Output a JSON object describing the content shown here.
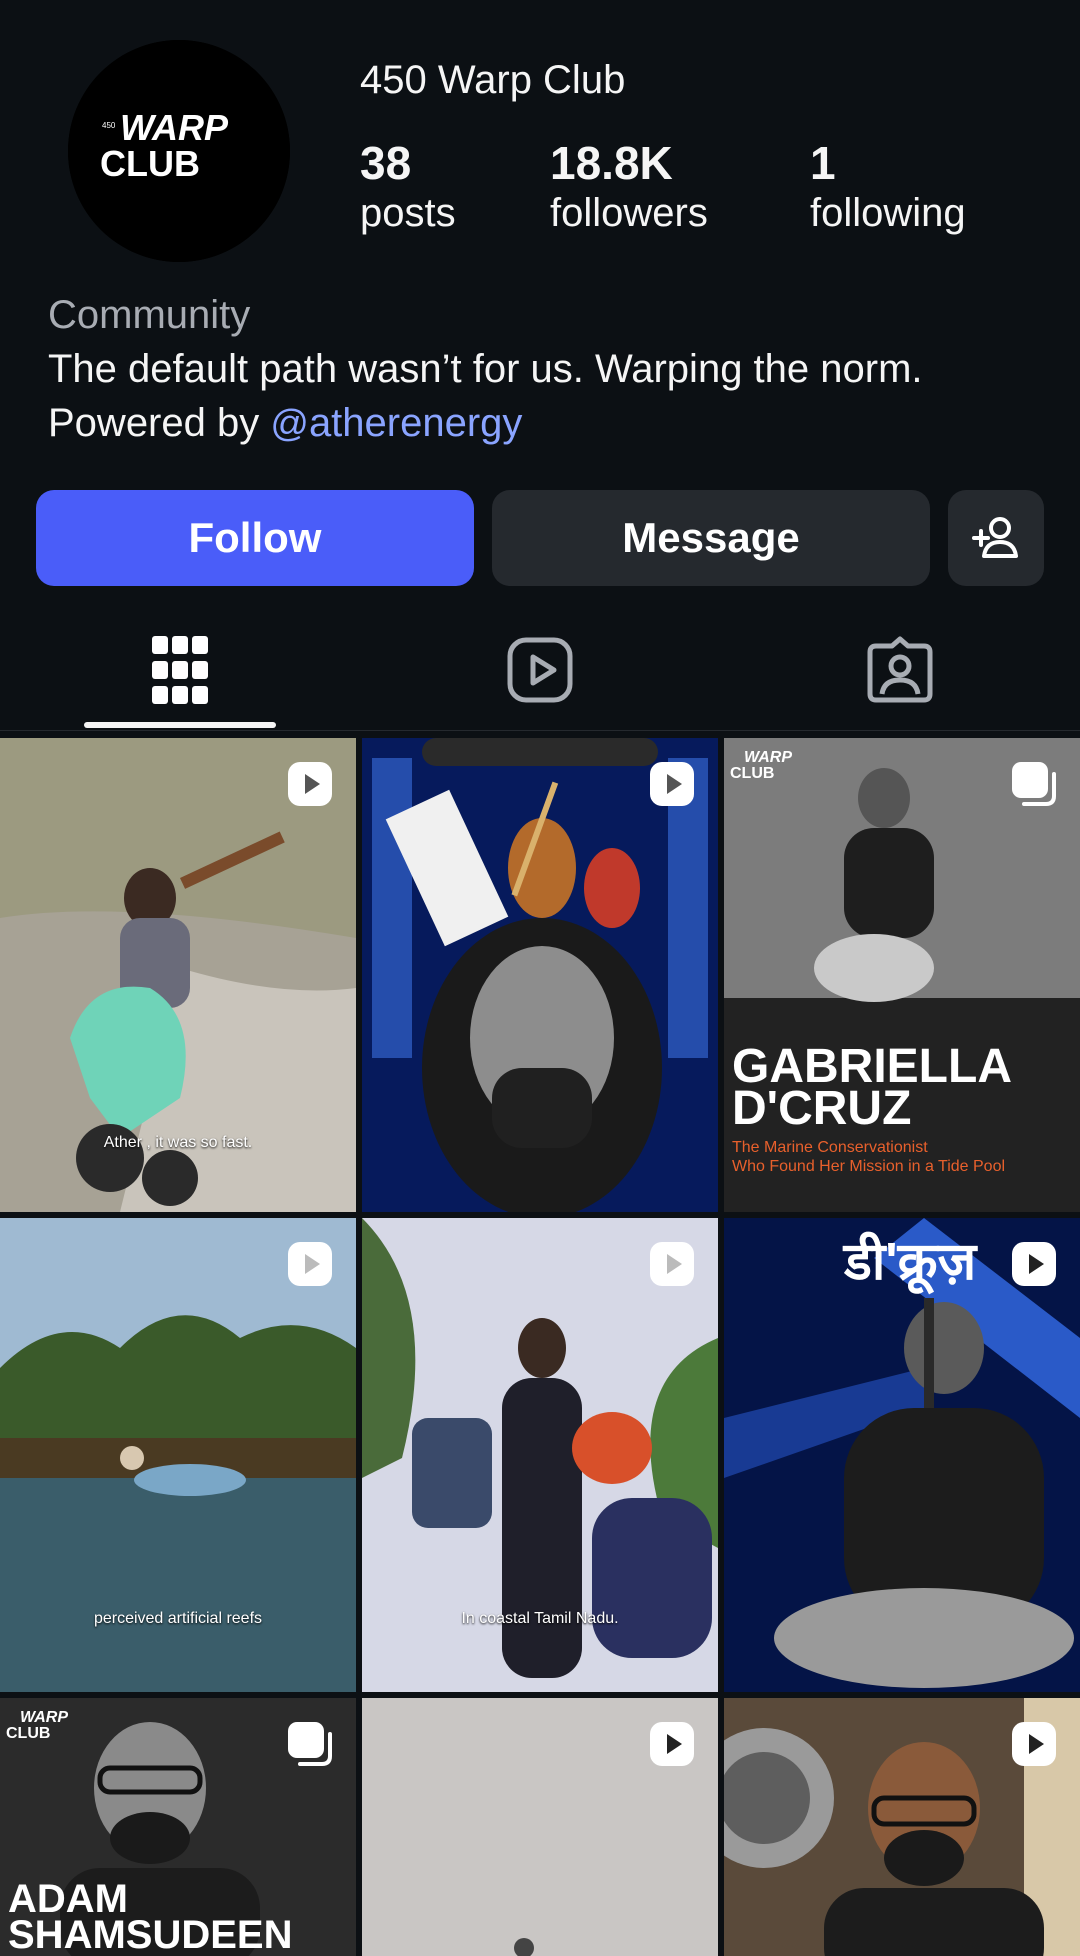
{
  "profile": {
    "name": "450 Warp Club",
    "posts_count": "38",
    "posts_label": "posts",
    "followers_count": "18.8K",
    "followers_label": "followers",
    "following_count": "1",
    "following_label": "following",
    "category": "Community",
    "bio_line1": "The default path wasn’t for us. Warping the norm.",
    "bio_powered": "Powered by",
    "bio_mention": "atherenergy",
    "avatar_text_top": "WARP",
    "avatar_text_bottom": "CLUB",
    "avatar_text_tiny": "450"
  },
  "actions": {
    "follow_label": "Follow",
    "message_label": "Message",
    "add_person_icon": "add-person-icon"
  },
  "tabs": [
    {
      "name": "posts-grid",
      "icon": "grid-icon",
      "active": true
    },
    {
      "name": "reels",
      "icon": "reels-icon",
      "active": false
    },
    {
      "name": "tagged",
      "icon": "tagged-icon",
      "active": false
    }
  ],
  "grid": {
    "tiles": [
      {
        "type": "reel",
        "caption": "Ather , it was so fast."
      },
      {
        "type": "reel",
        "caption": ""
      },
      {
        "type": "carousel",
        "title_line1": "GABRIELLA",
        "title_line2": "D'CRUZ",
        "subtitle_line1": "The Marine Conservationist",
        "subtitle_line2": "Who Found Her Mission in a Tide Pool",
        "logo_top": "WARP",
        "logo_bottom": "CLUB"
      },
      {
        "type": "reel",
        "caption": "perceived artificial reefs"
      },
      {
        "type": "reel",
        "caption": "In coastal Tamil Nadu."
      },
      {
        "type": "reel",
        "caption": "",
        "overlay_text": "डी'क्रूज़"
      },
      {
        "type": "carousel",
        "title_line1": "ADAM",
        "title_line2": "SHAMSUDEEN",
        "logo_top": "WARP",
        "logo_bottom": "CLUB"
      },
      {
        "type": "reel",
        "caption": ""
      },
      {
        "type": "reel",
        "caption": ""
      }
    ]
  },
  "colors": {
    "background": "#0c1014",
    "follow_button": "#4a5df9",
    "secondary_button": "#25292e",
    "mention": "#8aa4ff"
  }
}
